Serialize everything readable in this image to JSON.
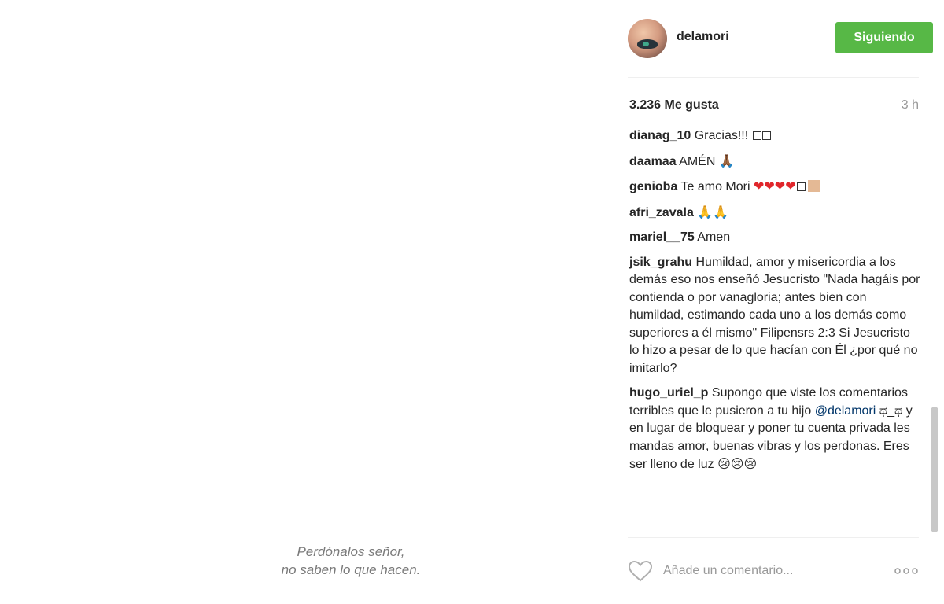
{
  "media": {
    "caption_line1": "Perdónalos señor,",
    "caption_line2": "no saben lo que hacen."
  },
  "header": {
    "username": "delamori",
    "follow_label": "Siguiendo",
    "follow_color": "#57b846"
  },
  "post": {
    "likes": "3.236 Me gusta",
    "time": "3 h"
  },
  "comments": [
    {
      "user": "dianag_10",
      "text": "Gracias!!!"
    },
    {
      "user": "daamaa",
      "text": "AMÉN",
      "emoji": "🙏🏾"
    },
    {
      "user": "genioba",
      "text": "Te amo Mori",
      "emoji": "❤❤❤❤"
    },
    {
      "user": "afri_zavala",
      "emoji": "🙏🙏"
    },
    {
      "user": "mariel__75",
      "text": "Amen"
    },
    {
      "user": "jsik_grahu",
      "text": "Humildad, amor y misericordia a los demás eso nos enseñó Jesucristo \"Nada hagáis por contienda o por vanagloria; antes bien con humildad, estimando cada uno a los demás como superiores a él mismo\" Filipensrs 2:3 Si Jesucristo lo hizo a pesar de lo que hacían con Él ¿por qué no imitarlo?"
    },
    {
      "user": "hugo_uriel_p",
      "text_before": "Supongo que viste los comentarios terribles que le pusieron a tu hijo",
      "mention": "@delamori",
      "text_after": "ಥ_ಥ y en lugar de bloquear y poner tu cuenta privada les mandas amor, buenas vibras y los perdonas. Eres ser lleno de luz",
      "emoji": "😢😢😢"
    }
  ],
  "add_comment": {
    "placeholder": "Añade un comentario..."
  },
  "icons": {
    "like": "heart-icon",
    "more": "more-options-icon"
  }
}
